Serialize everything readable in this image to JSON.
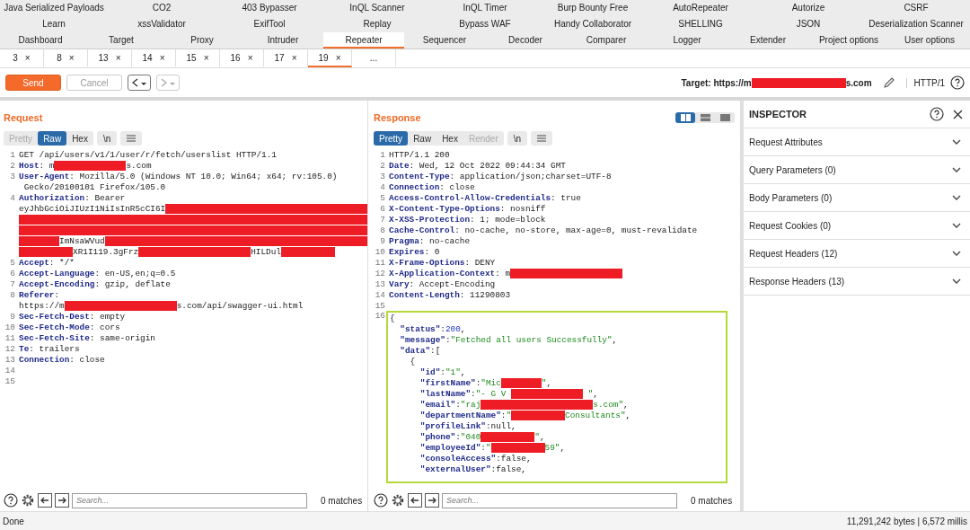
{
  "tab_rows": [
    [
      {
        "label": "Java Serialized Payloads",
        "selected": false
      },
      {
        "label": "CO2",
        "selected": false
      },
      {
        "label": "403 Bypasser",
        "selected": false
      },
      {
        "label": "InQL Scanner",
        "selected": false
      },
      {
        "label": "InQL Timer",
        "selected": false
      },
      {
        "label": "Burp Bounty Free",
        "selected": false
      },
      {
        "label": "AutoRepeater",
        "selected": false
      },
      {
        "label": "Autorize",
        "selected": false
      },
      {
        "label": "CSRF",
        "selected": false
      }
    ],
    [
      {
        "label": "Learn",
        "selected": false
      },
      {
        "label": "xssValidator",
        "selected": false
      },
      {
        "label": "ExifTool",
        "selected": false
      },
      {
        "label": "Replay",
        "selected": false
      },
      {
        "label": "Bypass WAF",
        "selected": false
      },
      {
        "label": "Handy Collaborator",
        "selected": false
      },
      {
        "label": "SHELLING",
        "selected": false
      },
      {
        "label": "JSON",
        "selected": false
      },
      {
        "label": "Deserialization Scanner",
        "selected": false
      }
    ],
    [
      {
        "label": "Dashboard",
        "selected": false
      },
      {
        "label": "Target",
        "selected": false
      },
      {
        "label": "Proxy",
        "selected": false
      },
      {
        "label": "Intruder",
        "selected": false
      },
      {
        "label": "Repeater",
        "selected": true
      },
      {
        "label": "Sequencer",
        "selected": false
      },
      {
        "label": "Decoder",
        "selected": false
      },
      {
        "label": "Comparer",
        "selected": false
      },
      {
        "label": "Logger",
        "selected": false
      },
      {
        "label": "Extender",
        "selected": false
      },
      {
        "label": "Project options",
        "selected": false
      },
      {
        "label": "User options",
        "selected": false
      }
    ]
  ],
  "repeater_tabs": [
    {
      "label": "3",
      "close": "×",
      "selected": false
    },
    {
      "label": "8",
      "close": "×",
      "selected": false
    },
    {
      "label": "13",
      "close": "×",
      "selected": false
    },
    {
      "label": "14",
      "close": "×",
      "selected": false
    },
    {
      "label": "15",
      "close": "×",
      "selected": false
    },
    {
      "label": "16",
      "close": "×",
      "selected": false
    },
    {
      "label": "17",
      "close": "×",
      "selected": false
    },
    {
      "label": "19",
      "close": "×",
      "selected": true
    },
    {
      "label": "..."
    }
  ],
  "toolbar": {
    "send": "Send",
    "cancel": "Cancel",
    "back_disabled": false,
    "forward_disabled": true,
    "target_prefix": "Target: https://m",
    "target_suffix": "s.com",
    "protocol": "HTTP/1"
  },
  "request": {
    "title": "Request",
    "tabs": [
      {
        "label": "Pretty",
        "selected": false,
        "disabled": true
      },
      {
        "label": "Raw",
        "selected": true,
        "disabled": false
      },
      {
        "label": "Hex",
        "selected": false,
        "disabled": false
      }
    ],
    "newline_toggle": "\\n",
    "lines": [
      {
        "n": "1",
        "parts": [
          {
            "kind": "plain",
            "text": "GET /api/users/v1/1/user/r/fetch/userslist HTTP/1.1"
          }
        ]
      },
      {
        "n": "2",
        "parts": [
          {
            "kind": "key",
            "text": "Host"
          },
          {
            "kind": "plain",
            "text": ": m"
          },
          {
            "kind": "mask_l"
          },
          {
            "kind": "plain",
            "text": "s.com"
          }
        ]
      },
      {
        "n": "3",
        "parts": [
          {
            "kind": "key",
            "text": "User-Agent"
          },
          {
            "kind": "plain",
            "text": ": Mozilla/5.0 (Windows NT 10.0; Win64; x64; rv:105.0)"
          }
        ]
      },
      {
        "parts": [
          {
            "kind": "plain",
            "text": " Gecko/20100101 Firefox/105.0"
          }
        ]
      },
      {
        "n": "4",
        "parts": [
          {
            "kind": "key",
            "text": "Authorization"
          },
          {
            "kind": "plain",
            "text": ": Bearer"
          }
        ]
      },
      {
        "parts": [
          {
            "kind": "plain",
            "text": "eyJhbGciOiJIUzI1NiIsInR5cCI6I"
          },
          {
            "kind": "mask_fill"
          }
        ]
      },
      {
        "parts": [
          {
            "kind": "mask_fill"
          }
        ]
      },
      {
        "parts": [
          {
            "kind": "mask_fill"
          }
        ]
      },
      {
        "parts": [
          {
            "kind": "mask_s"
          },
          {
            "kind": "plain",
            "text": "ImNsaWVud"
          },
          {
            "kind": "mask_fill"
          }
        ]
      },
      {
        "parts": [
          {
            "kind": "mask_m"
          },
          {
            "kind": "plain",
            "text": "XR1I119.3gFrz"
          },
          {
            "kind": "mask_xl"
          },
          {
            "kind": "plain",
            "text": "HILDul"
          },
          {
            "kind": "mask_m"
          }
        ]
      },
      {
        "n": "5",
        "parts": [
          {
            "kind": "key",
            "text": "Accept"
          },
          {
            "kind": "plain",
            "text": ": */*"
          }
        ]
      },
      {
        "n": "6",
        "parts": [
          {
            "kind": "key",
            "text": "Accept-Language"
          },
          {
            "kind": "plain",
            "text": ": en-US,en;q=0.5"
          }
        ]
      },
      {
        "n": "7",
        "parts": [
          {
            "kind": "key",
            "text": "Accept-Encoding"
          },
          {
            "kind": "plain",
            "text": ": gzip, deflate"
          }
        ]
      },
      {
        "n": "8",
        "parts": [
          {
            "kind": "key",
            "text": "Referer"
          },
          {
            "kind": "plain",
            "text": ":"
          }
        ]
      },
      {
        "parts": [
          {
            "kind": "plain",
            "text": "https://m"
          },
          {
            "kind": "mask_xl"
          },
          {
            "kind": "plain",
            "text": "s.com/api/swagger-ui.html"
          }
        ]
      },
      {
        "n": "9",
        "parts": [
          {
            "kind": "key",
            "text": "Sec-Fetch-Dest"
          },
          {
            "kind": "plain",
            "text": ": empty"
          }
        ]
      },
      {
        "n": "10",
        "parts": [
          {
            "kind": "key",
            "text": "Sec-Fetch-Mode"
          },
          {
            "kind": "plain",
            "text": ": cors"
          }
        ]
      },
      {
        "n": "11",
        "parts": [
          {
            "kind": "key",
            "text": "Sec-Fetch-Site"
          },
          {
            "kind": "plain",
            "text": ": same-origin"
          }
        ]
      },
      {
        "n": "12",
        "parts": [
          {
            "kind": "key",
            "text": "Te"
          },
          {
            "kind": "plain",
            "text": ": trailers"
          }
        ]
      },
      {
        "n": "13",
        "parts": [
          {
            "kind": "key",
            "text": "Connection"
          },
          {
            "kind": "plain",
            "text": ": close"
          }
        ]
      },
      {
        "n": "14"
      },
      {
        "n": "15"
      }
    ],
    "search": {
      "placeholder": "Search...",
      "matches": "0 matches"
    }
  },
  "response": {
    "title": "Response",
    "tabs": [
      {
        "label": "Pretty",
        "selected": true,
        "disabled": false
      },
      {
        "label": "Raw",
        "selected": false,
        "disabled": false
      },
      {
        "label": "Hex",
        "selected": false,
        "disabled": false
      },
      {
        "label": "Render",
        "selected": false,
        "disabled": true
      }
    ],
    "newline_toggle": "\\n",
    "layouts": [
      {
        "kind": "split",
        "selected": true
      },
      {
        "kind": "stacked",
        "selected": false
      },
      {
        "kind": "single",
        "selected": false
      }
    ],
    "lines": [
      {
        "n": "1",
        "parts": [
          {
            "kind": "plain",
            "text": "HTTP/1.1 200"
          }
        ]
      },
      {
        "n": "2",
        "parts": [
          {
            "kind": "key",
            "text": "Date"
          },
          {
            "kind": "plain",
            "text": ": Wed, 12 Oct 2022 09:44:34 GMT"
          }
        ]
      },
      {
        "n": "3",
        "parts": [
          {
            "kind": "key",
            "text": "Content-Type"
          },
          {
            "kind": "plain",
            "text": ": application/json;charset=UTF-8"
          }
        ]
      },
      {
        "n": "4",
        "parts": [
          {
            "kind": "key",
            "text": "Connection"
          },
          {
            "kind": "plain",
            "text": ": close"
          }
        ]
      },
      {
        "n": "5",
        "parts": [
          {
            "kind": "key",
            "text": "Access-Control-Allow-Credentials"
          },
          {
            "kind": "plain",
            "text": ": true"
          }
        ]
      },
      {
        "n": "6",
        "parts": [
          {
            "kind": "key",
            "text": "X-Content-Type-Options"
          },
          {
            "kind": "plain",
            "text": ": nosniff"
          }
        ]
      },
      {
        "n": "7",
        "parts": [
          {
            "kind": "key",
            "text": "X-XSS-Protection"
          },
          {
            "kind": "plain",
            "text": ": 1; mode=block"
          }
        ]
      },
      {
        "n": "8",
        "parts": [
          {
            "kind": "key",
            "text": "Cache-Control"
          },
          {
            "kind": "plain",
            "text": ": no-cache, no-store, max-age=0, must-revalidate"
          }
        ]
      },
      {
        "n": "9",
        "parts": [
          {
            "kind": "key",
            "text": "Pragma"
          },
          {
            "kind": "plain",
            "text": ": no-cache"
          }
        ]
      },
      {
        "n": "10",
        "parts": [
          {
            "kind": "key",
            "text": "Expires"
          },
          {
            "kind": "plain",
            "text": ": 0"
          }
        ]
      },
      {
        "n": "11",
        "parts": [
          {
            "kind": "key",
            "text": "X-Frame-Options"
          },
          {
            "kind": "plain",
            "text": ": DENY"
          }
        ]
      },
      {
        "n": "12",
        "parts": [
          {
            "kind": "key",
            "text": "X-Application-Context"
          },
          {
            "kind": "plain",
            "text": ": m"
          },
          {
            "kind": "mask_xl"
          }
        ]
      },
      {
        "n": "13",
        "parts": [
          {
            "kind": "key",
            "text": "Vary"
          },
          {
            "kind": "plain",
            "text": ": Accept-Encoding"
          }
        ]
      },
      {
        "n": "14",
        "parts": [
          {
            "kind": "key",
            "text": "Content-Length"
          },
          {
            "kind": "plain",
            "text": ": 11290803"
          }
        ]
      },
      {
        "n": "15"
      }
    ],
    "body": {
      "n": "16",
      "lines": [
        {
          "parts": [
            {
              "kind": "plain",
              "text": "{"
            }
          ]
        },
        {
          "parts": [
            {
              "kind": "key",
              "text": "  \"status\""
            },
            {
              "kind": "plain",
              "text": ":"
            },
            {
              "kind": "num",
              "text": "200"
            },
            {
              "kind": "plain",
              "text": ","
            }
          ]
        },
        {
          "parts": [
            {
              "kind": "key",
              "text": "  \"message\""
            },
            {
              "kind": "plain",
              "text": ":"
            },
            {
              "kind": "str",
              "text": "\"Fetched all users Successfully\""
            },
            {
              "kind": "plain",
              "text": ","
            }
          ]
        },
        {
          "parts": [
            {
              "kind": "key",
              "text": "  \"data\""
            },
            {
              "kind": "plain",
              "text": ":["
            }
          ]
        },
        {
          "parts": [
            {
              "kind": "plain",
              "text": "    {"
            }
          ]
        },
        {
          "parts": [
            {
              "kind": "key",
              "text": "      \"id\""
            },
            {
              "kind": "plain",
              "text": ":"
            },
            {
              "kind": "str",
              "text": "\"1\""
            },
            {
              "kind": "plain",
              "text": ","
            }
          ]
        },
        {
          "parts": [
            {
              "kind": "key",
              "text": "      \"firstName\""
            },
            {
              "kind": "plain",
              "text": ":"
            },
            {
              "kind": "str",
              "text": "\"Mic"
            },
            {
              "kind": "mask_s"
            },
            {
              "kind": "str",
              "text": "\""
            },
            {
              "kind": "plain",
              "text": ","
            }
          ]
        },
        {
          "parts": [
            {
              "kind": "key",
              "text": "      \"lastName\""
            },
            {
              "kind": "plain",
              "text": ":"
            },
            {
              "kind": "str",
              "text": "\"- G V "
            },
            {
              "kind": "mask_l"
            },
            {
              "kind": "str",
              "text": " \""
            },
            {
              "kind": "plain",
              "text": ","
            }
          ]
        },
        {
          "parts": [
            {
              "kind": "key",
              "text": "      \"email\""
            },
            {
              "kind": "plain",
              "text": ":"
            },
            {
              "kind": "str",
              "text": "\"raj"
            },
            {
              "kind": "mask_xl"
            },
            {
              "kind": "str",
              "text": "s.com\""
            },
            {
              "kind": "plain",
              "text": ","
            }
          ]
        },
        {
          "parts": [
            {
              "kind": "key",
              "text": "      \"departmentName\""
            },
            {
              "kind": "plain",
              "text": ":"
            },
            {
              "kind": "str",
              "text": "\""
            },
            {
              "kind": "mask_m"
            },
            {
              "kind": "str",
              "text": "Consultants\""
            },
            {
              "kind": "plain",
              "text": ","
            }
          ]
        },
        {
          "parts": [
            {
              "kind": "key",
              "text": "      \"profileLink\""
            },
            {
              "kind": "plain",
              "text": ":null,"
            }
          ]
        },
        {
          "parts": [
            {
              "kind": "key",
              "text": "      \"phone\""
            },
            {
              "kind": "plain",
              "text": ":"
            },
            {
              "kind": "str",
              "text": "\"040"
            },
            {
              "kind": "mask_m"
            },
            {
              "kind": "str",
              "text": "\""
            },
            {
              "kind": "plain",
              "text": ","
            }
          ]
        },
        {
          "parts": [
            {
              "kind": "key",
              "text": "      \"employeeId\""
            },
            {
              "kind": "plain",
              "text": ":"
            },
            {
              "kind": "str",
              "text": "\""
            },
            {
              "kind": "mask_m"
            },
            {
              "kind": "str",
              "text": "59\""
            },
            {
              "kind": "plain",
              "text": ","
            }
          ]
        },
        {
          "parts": [
            {
              "kind": "key",
              "text": "      \"consoleAccess\""
            },
            {
              "kind": "plain",
              "text": ":false,"
            }
          ]
        },
        {
          "parts": [
            {
              "kind": "key",
              "text": "      \"externalUser\""
            },
            {
              "kind": "plain",
              "text": ":false,"
            }
          ]
        }
      ]
    },
    "search": {
      "placeholder": "Search...",
      "matches": "0 matches"
    }
  },
  "inspector": {
    "title": "INSPECTOR",
    "sections": [
      "Request Attributes",
      "Query Parameters (0)",
      "Body Parameters (0)",
      "Request Cookies (0)",
      "Request Headers (12)",
      "Response Headers (13)"
    ]
  },
  "status_bar": {
    "left": "Done",
    "right": "11,291,242 bytes | 6,572 millis"
  }
}
